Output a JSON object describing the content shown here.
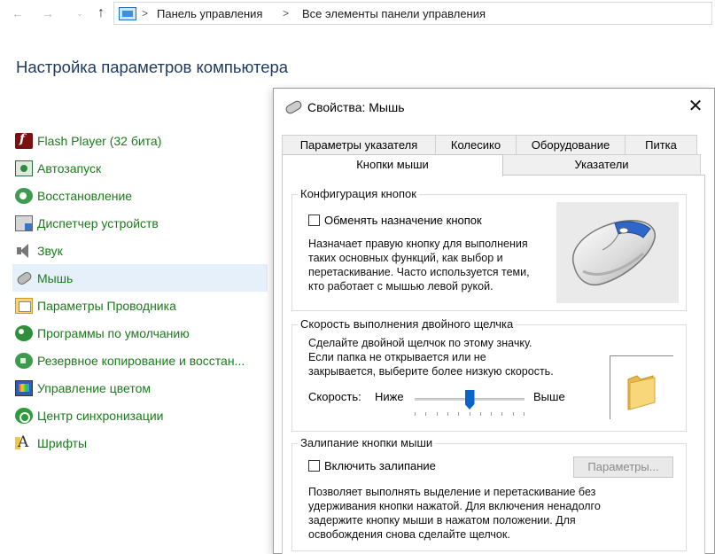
{
  "address_bar": {
    "back": "←",
    "forward": "→",
    "recent": "⌄",
    "up": "↑",
    "separator": ">",
    "crumbs": [
      "Панель управления",
      "Все элементы панели управления"
    ]
  },
  "page": {
    "title": "Настройка параметров компьютера"
  },
  "control_panel_items": [
    {
      "label": "Flash Player (32 бита)",
      "icon": "flash-icon"
    },
    {
      "label": "Автозапуск",
      "icon": "autoplay-icon"
    },
    {
      "label": "Восстановление",
      "icon": "recovery-icon"
    },
    {
      "label": "Диспетчер устройств",
      "icon": "device-manager-icon"
    },
    {
      "label": "Звук",
      "icon": "speaker-icon"
    },
    {
      "label": "Мышь",
      "icon": "mouse-icon",
      "selected": true
    },
    {
      "label": "Параметры Проводника",
      "icon": "explorer-options-icon"
    },
    {
      "label": "Программы по умолчанию",
      "icon": "default-programs-icon"
    },
    {
      "label": "Резервное копирование и восстан...",
      "icon": "backup-icon"
    },
    {
      "label": "Управление цветом",
      "icon": "color-management-icon"
    },
    {
      "label": "Центр синхронизации",
      "icon": "sync-center-icon"
    },
    {
      "label": "Шрифты",
      "icon": "fonts-icon"
    }
  ],
  "dialog": {
    "title": "Свойства: Мышь",
    "close": "✕",
    "tabs_row1": [
      "Параметры указателя",
      "Колесико",
      "Оборудование",
      "Питка"
    ],
    "tabs_row2": [
      "Кнопки мыши",
      "Указатели"
    ],
    "active_tab": "Кнопки мыши",
    "button_config": {
      "title": "Конфигурация кнопок",
      "checkbox_label": "Обменять назначение кнопок",
      "checked": false,
      "description": [
        "Назначает правую кнопку для выполнения",
        "таких основных функций, как выбор и",
        "перетаскивание. Часто используется теми,",
        "кто работает с мышью левой рукой."
      ]
    },
    "double_click": {
      "title": "Скорость выполнения двойного щелчка",
      "description": [
        "Сделайте двойной щелчок по этому значку.",
        "Если папка не открывается или не",
        "закрывается, выберите более низкую скорость."
      ],
      "speed_label": "Скорость:",
      "low_label": "Ниже",
      "high_label": "Выше",
      "slider_value_fraction": 0.5,
      "tick_count": 11
    },
    "click_lock": {
      "title": "Залипание кнопки мыши",
      "checkbox_label": "Включить залипание",
      "checked": false,
      "settings_button": "Параметры...",
      "settings_enabled": false,
      "description": [
        "Позволяет выполнять выделение и перетаскивание без",
        "удерживания кнопки нажатой. Для включения ненадолго",
        "задержите кнопку мыши в нажатом положении. Для",
        "освобождения снова сделайте щелчок."
      ]
    }
  }
}
